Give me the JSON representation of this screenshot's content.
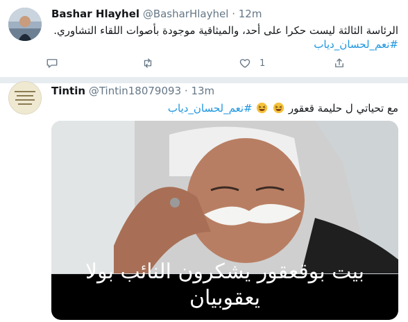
{
  "tweets": [
    {
      "name": "Bashar Hlayhel",
      "handle": "@BasharHlayhel",
      "separator": "·",
      "time": "12m",
      "text_line1": "الرئاسة الثالثة ليست حكرا على أحد، والميثاقية موجودة بأصوات اللقاء التشاوري.",
      "hashtag": "#نعم_لحسان_دياب",
      "like_count": "1",
      "icons": [
        "reply-icon",
        "retweet-icon",
        "like-icon",
        "share-icon"
      ]
    },
    {
      "name": "Tintin",
      "handle": "@Tintin18079093",
      "separator": "·",
      "time": "13m",
      "text_start": "مع تحياتي ل حليمة قعقور",
      "hashtag": "#نعم_لحسان_دياب",
      "emoji": "grinning-squinting-face",
      "media_caption": "بيت بوقعقور يشكرون النائب بولا يعقوبيان"
    }
  ],
  "colors": {
    "link": "#1b95e0",
    "secondary_text": "#657786",
    "divider": "#e6ecf0"
  }
}
